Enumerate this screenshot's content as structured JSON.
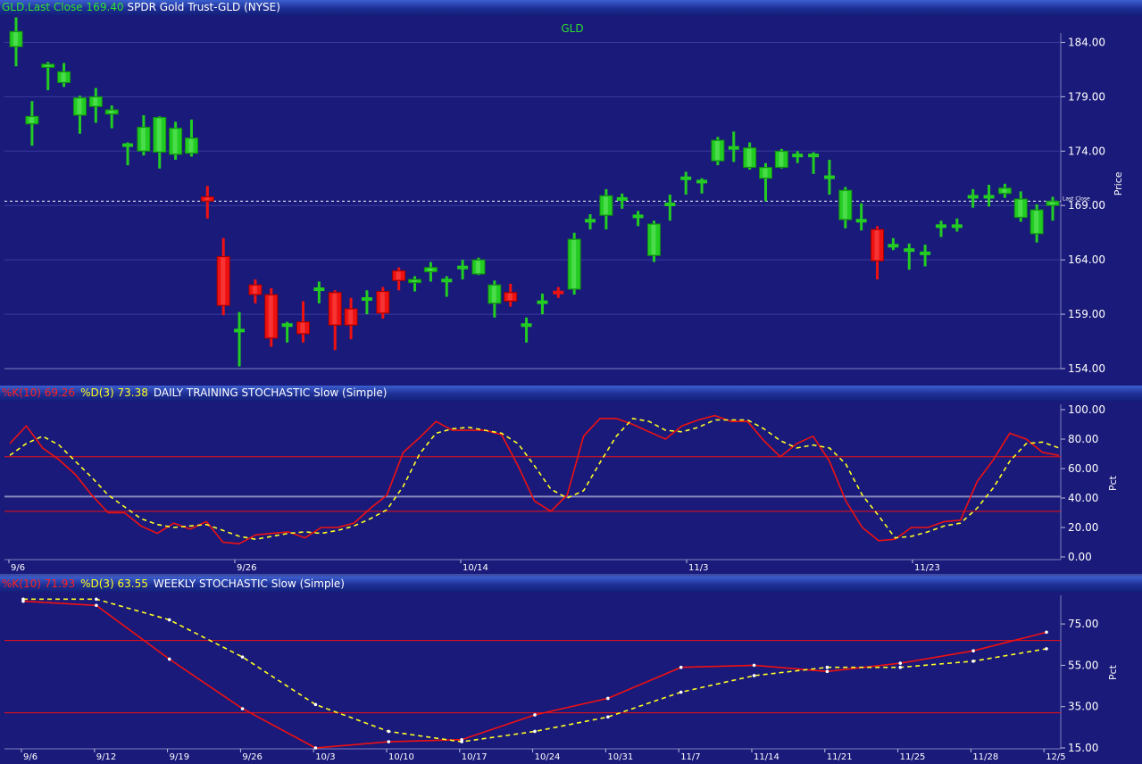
{
  "price_panel": {
    "header": {
      "symbol_last": "GLD.Last Close",
      "last_value": "169.40",
      "description": "SPDR Gold Trust-GLD (NYSE)"
    },
    "center_title": "GLD",
    "axis_label": "Price",
    "last_close_tag": "Last Close",
    "last_close_value": 169.4
  },
  "daily_panel": {
    "header": {
      "k_label": "%K(10) 69.26",
      "d_label": "%D(3) 73.38",
      "title": "DAILY TRAINING STOCHASTIC Slow (Simple)"
    },
    "axis_label": "Pct"
  },
  "weekly_panel": {
    "header": {
      "k_label": "%K(10) 71.93",
      "d_label": "%D(3) 63.55",
      "title": "WEEKLY STOCHASTIC Slow (Simple)"
    },
    "axis_label": "Pct"
  },
  "colors": {
    "background": "#1a1a7a",
    "up": "#22cc22",
    "down": "#ee1111",
    "k_line": "#ee1111",
    "d_line": "#ffff22",
    "grid": "#3a3aa0"
  },
  "chart_data": [
    {
      "type": "candlestick",
      "title": "GLD",
      "ylabel": "Price",
      "ylim": [
        154,
        186.5
      ],
      "yticks": [
        "184.00",
        "179.00",
        "174.00",
        "169.00",
        "164.00",
        "159.00",
        "154.00"
      ],
      "last_close": 169.4,
      "candles": [
        {
          "o": 183.6,
          "c": 185.0,
          "h": 186.3,
          "l": 181.8
        },
        {
          "o": 176.5,
          "c": 177.2,
          "h": 178.6,
          "l": 174.5
        },
        {
          "o": 181.7,
          "c": 182.0,
          "h": 182.2,
          "l": 179.6
        },
        {
          "o": 180.3,
          "c": 181.3,
          "h": 182.1,
          "l": 179.9
        },
        {
          "o": 177.3,
          "c": 178.9,
          "h": 179.1,
          "l": 175.6
        },
        {
          "o": 178.1,
          "c": 179.0,
          "h": 179.8,
          "l": 176.6
        },
        {
          "o": 177.4,
          "c": 177.8,
          "h": 178.2,
          "l": 176.1
        },
        {
          "o": 174.5,
          "c": 174.6,
          "h": 174.8,
          "l": 172.7
        },
        {
          "o": 174.0,
          "c": 176.2,
          "h": 177.3,
          "l": 173.6
        },
        {
          "o": 173.9,
          "c": 177.1,
          "h": 177.2,
          "l": 172.4
        },
        {
          "o": 173.7,
          "c": 176.1,
          "h": 176.7,
          "l": 173.2
        },
        {
          "o": 173.8,
          "c": 175.2,
          "h": 176.9,
          "l": 173.5
        },
        {
          "o": 169.8,
          "c": 169.4,
          "h": 170.8,
          "l": 167.8
        },
        {
          "o": 164.3,
          "c": 159.8,
          "h": 166.0,
          "l": 158.9
        },
        {
          "o": 157.5,
          "c": 157.5,
          "h": 159.2,
          "l": 154.2
        },
        {
          "o": 161.7,
          "c": 160.8,
          "h": 162.2,
          "l": 160.0
        },
        {
          "o": 160.8,
          "c": 156.8,
          "h": 161.4,
          "l": 156.0
        },
        {
          "o": 158.0,
          "c": 158.0,
          "h": 158.3,
          "l": 156.4
        },
        {
          "o": 158.3,
          "c": 157.2,
          "h": 160.2,
          "l": 156.4
        },
        {
          "o": 161.3,
          "c": 161.3,
          "h": 162.0,
          "l": 160.0
        },
        {
          "o": 161.0,
          "c": 158.0,
          "h": 161.2,
          "l": 155.7
        },
        {
          "o": 159.5,
          "c": 158.0,
          "h": 160.5,
          "l": 156.7
        },
        {
          "o": 160.4,
          "c": 160.4,
          "h": 161.2,
          "l": 159.0
        },
        {
          "o": 161.1,
          "c": 159.1,
          "h": 161.5,
          "l": 158.6
        },
        {
          "o": 163.0,
          "c": 162.1,
          "h": 163.3,
          "l": 161.2
        },
        {
          "o": 161.9,
          "c": 162.2,
          "h": 162.5,
          "l": 161.1
        },
        {
          "o": 162.9,
          "c": 163.3,
          "h": 163.8,
          "l": 162.0
        },
        {
          "o": 162.1,
          "c": 162.1,
          "h": 162.5,
          "l": 160.6
        },
        {
          "o": 163.3,
          "c": 163.3,
          "h": 164.0,
          "l": 162.2
        },
        {
          "o": 162.7,
          "c": 164.0,
          "h": 164.2,
          "l": 162.6
        },
        {
          "o": 160.0,
          "c": 161.7,
          "h": 162.1,
          "l": 158.7
        },
        {
          "o": 161.0,
          "c": 160.2,
          "h": 161.8,
          "l": 159.7
        },
        {
          "o": 158.0,
          "c": 158.0,
          "h": 158.7,
          "l": 156.4
        },
        {
          "o": 160.1,
          "c": 160.1,
          "h": 160.9,
          "l": 159.0
        },
        {
          "o": 161.1,
          "c": 160.9,
          "h": 161.5,
          "l": 160.5
        },
        {
          "o": 161.3,
          "c": 165.9,
          "h": 166.5,
          "l": 160.8
        },
        {
          "o": 167.6,
          "c": 167.6,
          "h": 168.2,
          "l": 166.8
        },
        {
          "o": 168.1,
          "c": 169.9,
          "h": 170.5,
          "l": 166.8
        },
        {
          "o": 169.6,
          "c": 169.6,
          "h": 170.1,
          "l": 168.7
        },
        {
          "o": 168.0,
          "c": 168.0,
          "h": 168.5,
          "l": 167.1
        },
        {
          "o": 164.4,
          "c": 167.3,
          "h": 167.6,
          "l": 163.8
        },
        {
          "o": 169.1,
          "c": 169.1,
          "h": 170.0,
          "l": 167.6
        },
        {
          "o": 171.5,
          "c": 171.5,
          "h": 172.1,
          "l": 170.0
        },
        {
          "o": 171.2,
          "c": 171.2,
          "h": 171.5,
          "l": 170.1
        },
        {
          "o": 173.1,
          "c": 175.0,
          "h": 175.3,
          "l": 172.7
        },
        {
          "o": 174.3,
          "c": 174.3,
          "h": 175.8,
          "l": 173.0
        },
        {
          "o": 172.5,
          "c": 174.3,
          "h": 174.8,
          "l": 172.3
        },
        {
          "o": 171.5,
          "c": 172.5,
          "h": 172.9,
          "l": 169.4
        },
        {
          "o": 172.5,
          "c": 174.0,
          "h": 174.2,
          "l": 172.4
        },
        {
          "o": 173.6,
          "c": 173.6,
          "h": 174.0,
          "l": 172.9
        },
        {
          "o": 173.6,
          "c": 173.6,
          "h": 173.9,
          "l": 171.9
        },
        {
          "o": 171.6,
          "c": 171.6,
          "h": 173.2,
          "l": 170.0
        },
        {
          "o": 167.7,
          "c": 170.4,
          "h": 170.7,
          "l": 166.9
        },
        {
          "o": 167.6,
          "c": 167.6,
          "h": 169.2,
          "l": 166.7
        },
        {
          "o": 166.8,
          "c": 163.9,
          "h": 167.1,
          "l": 162.2
        },
        {
          "o": 165.3,
          "c": 165.3,
          "h": 166.0,
          "l": 164.9
        },
        {
          "o": 164.9,
          "c": 164.9,
          "h": 165.5,
          "l": 163.1
        },
        {
          "o": 164.6,
          "c": 164.6,
          "h": 165.4,
          "l": 163.4
        },
        {
          "o": 167.1,
          "c": 167.1,
          "h": 167.6,
          "l": 166.1
        },
        {
          "o": 167.1,
          "c": 167.1,
          "h": 167.8,
          "l": 166.6
        },
        {
          "o": 169.8,
          "c": 169.8,
          "h": 170.5,
          "l": 168.8
        },
        {
          "o": 169.8,
          "c": 169.8,
          "h": 170.9,
          "l": 168.9
        },
        {
          "o": 170.1,
          "c": 170.6,
          "h": 171.0,
          "l": 169.7
        },
        {
          "o": 167.9,
          "c": 169.6,
          "h": 170.3,
          "l": 167.5
        },
        {
          "o": 166.4,
          "c": 168.6,
          "h": 169.1,
          "l": 165.6
        },
        {
          "o": 169.0,
          "c": 169.4,
          "h": 169.8,
          "l": 167.6
        }
      ]
    },
    {
      "type": "line",
      "title": "DAILY TRAINING STOCHASTIC Slow (Simple)",
      "ylabel": "Pct",
      "ylim": [
        0,
        100
      ],
      "yticks": [
        "100.00",
        "80.00",
        "60.00",
        "40.00",
        "20.00",
        "0.00"
      ],
      "xticks": [
        "9/6",
        "9/26",
        "10/14",
        "11/3",
        "11/23"
      ],
      "reference_lines": [
        {
          "y": 68,
          "color": "#ee1111"
        },
        {
          "y": 31,
          "color": "#ee1111"
        },
        {
          "y": 41,
          "color": "#8a8ac0"
        }
      ],
      "series": [
        {
          "name": "%K(10)",
          "color": "#ee1111",
          "dashed": false,
          "values": [
            77,
            89,
            74,
            66,
            56,
            42,
            30,
            30,
            21,
            16,
            23,
            19,
            24,
            10,
            9,
            15,
            16,
            17,
            13,
            20,
            20,
            23,
            33,
            42,
            71,
            81,
            92,
            86,
            86,
            86,
            83,
            62,
            38,
            31,
            42,
            82,
            94,
            94,
            90,
            85,
            80,
            89,
            93,
            96,
            92,
            92,
            79,
            68,
            77,
            82,
            65,
            38,
            20,
            11,
            12,
            20,
            20,
            24,
            25,
            51,
            66,
            84,
            80,
            71,
            69
          ]
        },
        {
          "name": "%D(3)",
          "color": "#ffff22",
          "dashed": true,
          "values": [
            69,
            77,
            82,
            76,
            65,
            54,
            42,
            34,
            26,
            22,
            20,
            21,
            22,
            18,
            14,
            12,
            14,
            16,
            17,
            16,
            18,
            21,
            26,
            32,
            48,
            70,
            84,
            87,
            88,
            86,
            84,
            77,
            62,
            46,
            40,
            45,
            64,
            82,
            94,
            92,
            86,
            85,
            88,
            93,
            93,
            93,
            87,
            79,
            74,
            76,
            74,
            63,
            42,
            28,
            13,
            14,
            17,
            21,
            23,
            33,
            47,
            65,
            77,
            78,
            74
          ]
        }
      ]
    },
    {
      "type": "line",
      "title": "WEEKLY STOCHASTIC Slow (Simple)",
      "ylabel": "Pct",
      "ylim": [
        15,
        88
      ],
      "yticks": [
        "75.00",
        "55.00",
        "35.00",
        "15.00"
      ],
      "xticks": [
        "9/6",
        "9/12",
        "9/19",
        "9/26",
        "10/3",
        "10/10",
        "10/17",
        "10/24",
        "10/31",
        "11/7",
        "11/14",
        "11/21",
        "11/25",
        "11/28",
        "12/5"
      ],
      "reference_lines": [
        {
          "y": 67,
          "color": "#ee1111"
        },
        {
          "y": 32,
          "color": "#ee1111"
        }
      ],
      "series": [
        {
          "name": "%K(10)",
          "color": "#ee1111",
          "dashed": false,
          "values": [
            86,
            84,
            58,
            34,
            15,
            18,
            19,
            31,
            39,
            54,
            55,
            52,
            56,
            62,
            71
          ]
        },
        {
          "name": "%D(3)",
          "color": "#ffff22",
          "dashed": true,
          "values": [
            87,
            87,
            77,
            59,
            36,
            23,
            18,
            23,
            30,
            42,
            50,
            54,
            54,
            57,
            63
          ]
        }
      ]
    }
  ]
}
